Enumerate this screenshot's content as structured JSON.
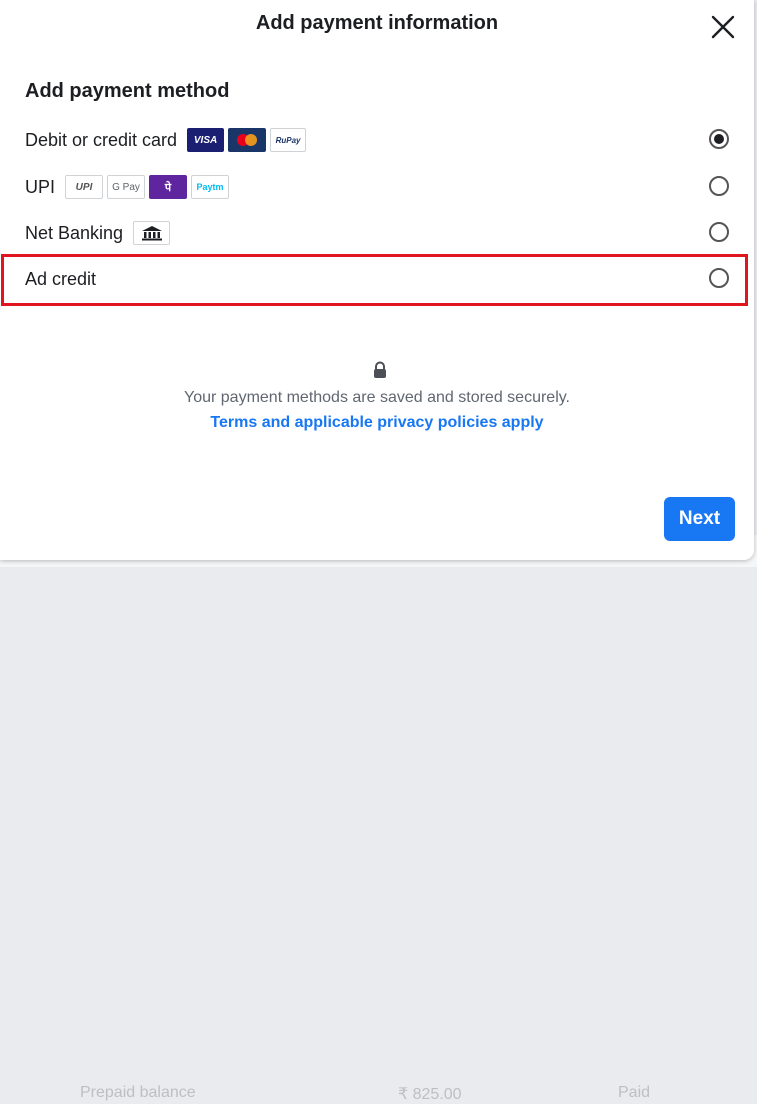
{
  "background": {
    "row_texts": [
      "Prepaid balance",
      "₹ 825.00",
      "Paid"
    ]
  },
  "modal": {
    "title": "Add payment information",
    "section_title": "Add payment method",
    "options": [
      {
        "label": "Debit or credit card",
        "selected": true,
        "logos": [
          "VISA",
          "mastercard",
          "RuPay"
        ]
      },
      {
        "label": "UPI",
        "selected": false,
        "logos": [
          "UPI",
          "G Pay",
          "PhonePe",
          "Paytm"
        ]
      },
      {
        "label": "Net Banking",
        "selected": false,
        "logos": [
          "bank-icon"
        ]
      },
      {
        "label": "Ad credit",
        "selected": false,
        "logos": []
      }
    ],
    "secure_text": "Your payment methods are saved and stored securely.",
    "terms_link": "Terms and applicable privacy policies apply",
    "next_label": "Next"
  },
  "colors": {
    "accent": "#1877f2",
    "highlight": "#e0161e",
    "visa": "#1a1f71",
    "mastercard_bg": "#1a3568",
    "phonepe": "#5f259f"
  }
}
